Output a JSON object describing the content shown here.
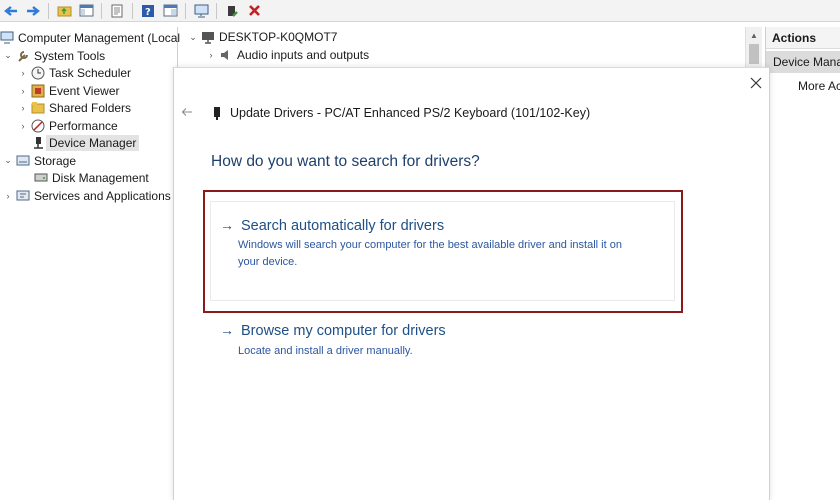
{
  "toolbar": {
    "buttons": [
      "back-arrow-icon",
      "forward-arrow-icon",
      "up-folder-icon",
      "show-hide-tree-icon",
      "properties-icon",
      "help-icon",
      "view-icon",
      "monitor-icon",
      "update-driver-icon",
      "uninstall-icon"
    ],
    "colors": {
      "blue": "#2f7bd8",
      "red": "#c82020",
      "green": "#3a9a3a"
    }
  },
  "tree": {
    "root": "Computer Management (Local)",
    "system_tools": "System Tools",
    "task_scheduler": "Task Scheduler",
    "event_viewer": "Event Viewer",
    "shared_folders": "Shared Folders",
    "performance": "Performance",
    "device_manager": "Device Manager",
    "storage": "Storage",
    "disk_management": "Disk Management",
    "services_apps": "Services and Applications"
  },
  "middle": {
    "computer": "DESKTOP-K0QMOT7",
    "audio": "Audio inputs and outputs"
  },
  "actions": {
    "title": "Actions",
    "selected": "Device Mana",
    "more": "More Ac"
  },
  "dialog": {
    "title": "Update Drivers - PC/AT Enhanced PS/2 Keyboard (101/102-Key)",
    "heading": "How do you want to search for drivers?",
    "option1": {
      "title": "Search automatically for drivers",
      "desc_line1": "Windows will search your computer for the best available driver and install it on",
      "desc_line2": "your device."
    },
    "option2": {
      "title": "Browse my computer for drivers",
      "desc": "Locate and install a driver manually."
    },
    "colors": {
      "heading": "#1f3f6b",
      "link": "#1e4f86",
      "highlight_border": "#8b1a1a"
    }
  }
}
